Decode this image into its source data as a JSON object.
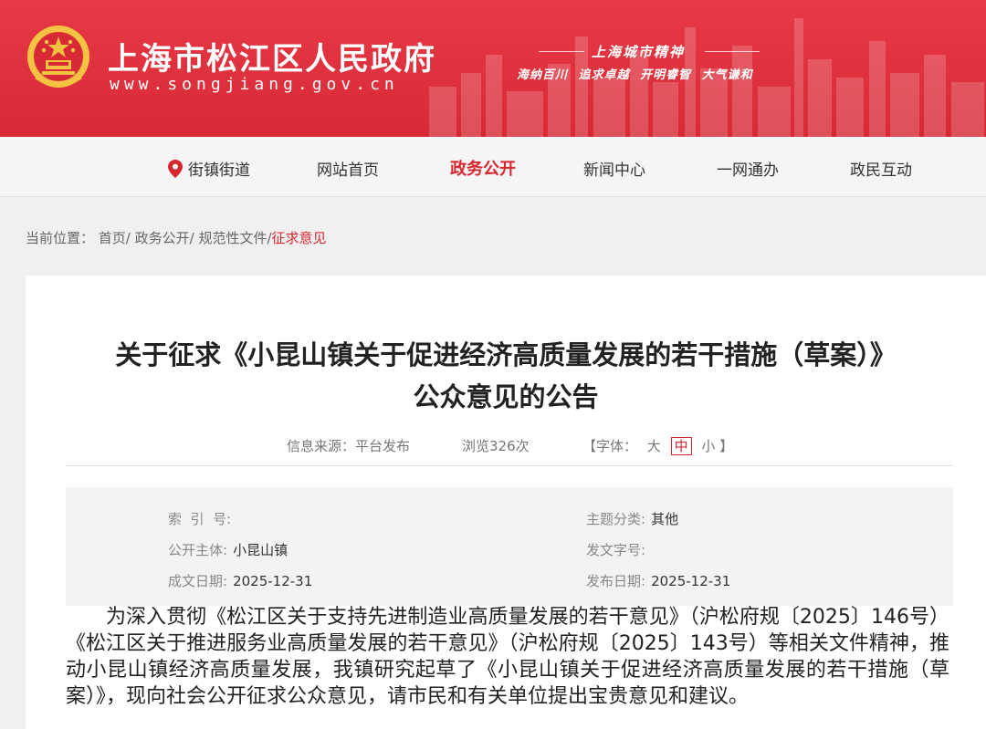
{
  "header": {
    "site_title": "上海市松江区人民政府",
    "site_domain": "www.songjiang.gov.cn",
    "spirit_title": "上海城市精神",
    "spirit_items": [
      "海纳百川",
      "追求卓越",
      "开明睿智",
      "大气谦和"
    ]
  },
  "nav": {
    "items": [
      {
        "label": "街镇街道"
      },
      {
        "label": "网站首页"
      },
      {
        "label": "政务公开"
      },
      {
        "label": "新闻中心"
      },
      {
        "label": "一网通办"
      },
      {
        "label": "政民互动"
      }
    ]
  },
  "breadcrumb": {
    "prefix": "当前位置：",
    "home": "首页/",
    "level1": "政务公开/",
    "level2": "规范性文件/",
    "current": "征求意见"
  },
  "article": {
    "title_line1": "关于征求《小昆山镇关于促进经济高质量发展的若干措施（草案）》",
    "title_line2": "公众意见的公告",
    "source_label": "信息来源：",
    "source_value": "平台发布",
    "views": "浏览326次",
    "font_label": "【字体：",
    "font_large": "大",
    "font_medium": "中",
    "font_small": "小",
    "font_close": "】",
    "info": {
      "index_label": "索  引  号:",
      "index_value": "",
      "category_label": "主题分类:",
      "category_value": "其他",
      "publisher_label": "公开主体:",
      "publisher_value": "小昆山镇",
      "docno_label": "发文字号:",
      "docno_value": "",
      "written_label": "成文日期:",
      "written_value": "2025-12-31",
      "published_label": "发布日期:",
      "published_value": "2025-12-31"
    },
    "body": "为深入贯彻《松江区关于支持先进制造业高质量发展的若干意见》（沪松府规〔2025〕146号）《松江区关于推进服务业高质量发展的若干意见》（沪松府规〔2025〕143号）等相关文件精神，推动小昆山镇经济高质量发展，我镇研究起草了《小昆山镇关于促进经济高质量发展的若干措施（草案）》，现向社会公开征求公众意见，请市民和有关单位提出宝贵意见和建议。"
  },
  "colors": {
    "brand_red": "#d8262f",
    "header_red": "#e83a46"
  }
}
